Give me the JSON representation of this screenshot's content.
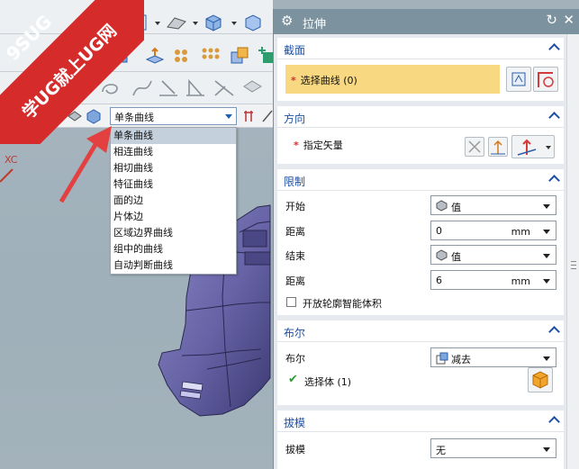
{
  "watermark": {
    "brand": "9SUG",
    "slogan": "学UG就上UG网"
  },
  "filter": {
    "selected": "单条曲线",
    "options": [
      "单条曲线",
      "相连曲线",
      "相切曲线",
      "特征曲线",
      "面的边",
      "片体边",
      "区域边界曲线",
      "组中的曲线",
      "自动判断曲线"
    ]
  },
  "viewport": {
    "axis_label": "XC"
  },
  "dialog": {
    "title": "拉伸",
    "section": {
      "title": "截面",
      "select_curve": "选择曲线 (0)"
    },
    "direction": {
      "title": "方向",
      "vector": "指定矢量"
    },
    "limits": {
      "title": "限制",
      "start_label": "开始",
      "start_value": "值",
      "start_dist_label": "距离",
      "start_dist": "0",
      "start_unit": "mm",
      "end_label": "结束",
      "end_value": "值",
      "end_dist_label": "距离",
      "end_dist": "6",
      "end_unit": "mm",
      "open_profile": "开放轮廓智能体积"
    },
    "boolean": {
      "title": "布尔",
      "label": "布尔",
      "value": "减去",
      "select_body": "选择体 (1)"
    },
    "draft": {
      "title": "拔模",
      "label": "拔模",
      "value": "无"
    }
  },
  "colors": {
    "title_bar": "#7c939f",
    "section_title": "#1e50a2",
    "selection_highlight": "#f8d982",
    "model": "#6b68a8",
    "watermark": "#d52b2b"
  }
}
